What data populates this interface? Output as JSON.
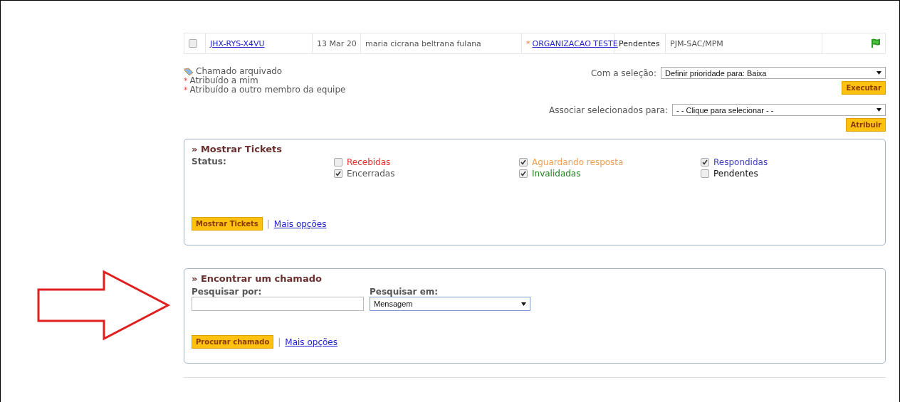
{
  "ticket_row": {
    "checked": false,
    "id": "JHX-RYS-X4VU",
    "date": "13 Mar 20",
    "name": "maria cicrana beltrana fulana",
    "mark": "*",
    "organization": "ORGANIZACAO TESTE",
    "status": "Pendentes",
    "department": "PJM-SAC/MPM"
  },
  "legend": [
    {
      "kind": "icon",
      "label": "Chamado arquivado"
    },
    {
      "kind": "star",
      "mark": "*",
      "label": "Atribuído a mim"
    },
    {
      "kind": "star",
      "mark": "*",
      "label": "Atribuído a outro membro da equipe"
    }
  ],
  "bulk_actions": [
    {
      "label": "Com a seleção:",
      "value": "Definir prioridade para: Baixa",
      "button": "Executar"
    },
    {
      "label": "Associar selecionados para:",
      "value": "- - Clique para selecionar - -",
      "button": "Atribuir"
    }
  ],
  "show_tickets": {
    "title": "» Mostrar Tickets",
    "status_label": "Status:",
    "statuses": [
      {
        "label": "Recebidas",
        "checked": false,
        "color": "#e03030"
      },
      {
        "label": "Aguardando resposta",
        "checked": true,
        "color": "#f0a050"
      },
      {
        "label": "Respondidas",
        "checked": true,
        "color": "#4040c0"
      },
      {
        "label": "Encerradas",
        "checked": true,
        "color": "#555555"
      },
      {
        "label": "Invalidadas",
        "checked": true,
        "color": "#208020"
      },
      {
        "label": "Pendentes",
        "checked": false,
        "color": "#111111"
      }
    ],
    "button": "Mostrar Tickets",
    "separator": "|",
    "link": "Mais opções"
  },
  "find_ticket": {
    "title": "» Encontrar um chamado",
    "search_label": "Pesquisar por:",
    "in_label": "Pesquisar em:",
    "in_value": "Mensagem",
    "button": "Procurar chamado",
    "separator": "|",
    "link": "Mais opções"
  }
}
